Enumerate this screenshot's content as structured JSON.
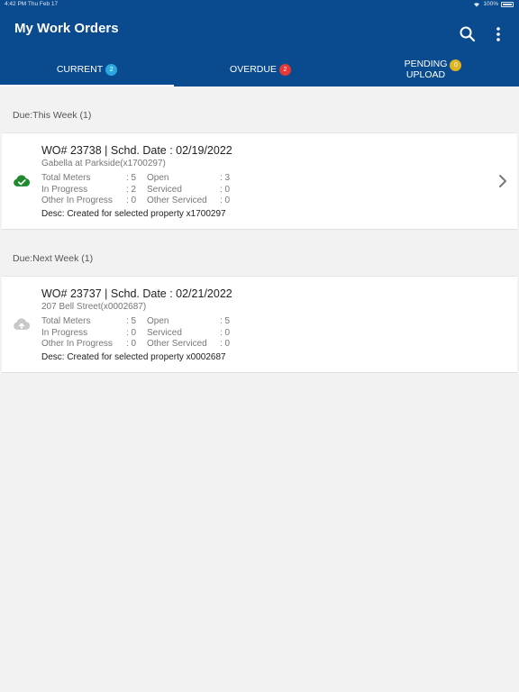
{
  "status_bar": {
    "time": "4:42 PM  Thu Feb 17",
    "battery": "100%"
  },
  "header": {
    "title": "My Work Orders"
  },
  "tabs": [
    {
      "label": "CURRENT",
      "count": "2",
      "color": "#2aa8e0"
    },
    {
      "label": "OVERDUE",
      "count": "2",
      "color": "#e53935"
    },
    {
      "label_line1": "PENDING",
      "label_line2": "UPLOAD",
      "count": "0",
      "color": "#e0b420"
    }
  ],
  "sections": [
    {
      "title": "Due:This Week (1)",
      "order": {
        "title": "WO# 23738 | Schd. Date : 02/19/2022",
        "property": "Gabella at Parkside(x1700297)",
        "status_icon": "cloud-check-icon",
        "status_color": "#1e8a2e",
        "stats": [
          [
            "Total Meters",
            ": 5",
            "Open",
            ": 3"
          ],
          [
            "In Progress",
            ": 2",
            "Serviced",
            ": 0"
          ],
          [
            "Other In Progress",
            ": 0",
            "Other Serviced",
            ": 0"
          ]
        ],
        "desc": "Desc: Created for selected property x1700297"
      }
    },
    {
      "title": "Due:Next Week (1)",
      "order": {
        "title": "WO# 23737 | Schd. Date : 02/21/2022",
        "property": "207 Bell Street(x0002687)",
        "status_icon": "cloud-upload-icon",
        "status_color": "#c8c8c8",
        "stats": [
          [
            "Total Meters",
            ": 5",
            "Open",
            ": 5"
          ],
          [
            "In Progress",
            ": 0",
            "Serviced",
            ": 0"
          ],
          [
            "Other In Progress",
            ": 0",
            "Other Serviced",
            ": 0"
          ]
        ],
        "desc": "Desc: Created for selected property x0002687"
      }
    }
  ]
}
